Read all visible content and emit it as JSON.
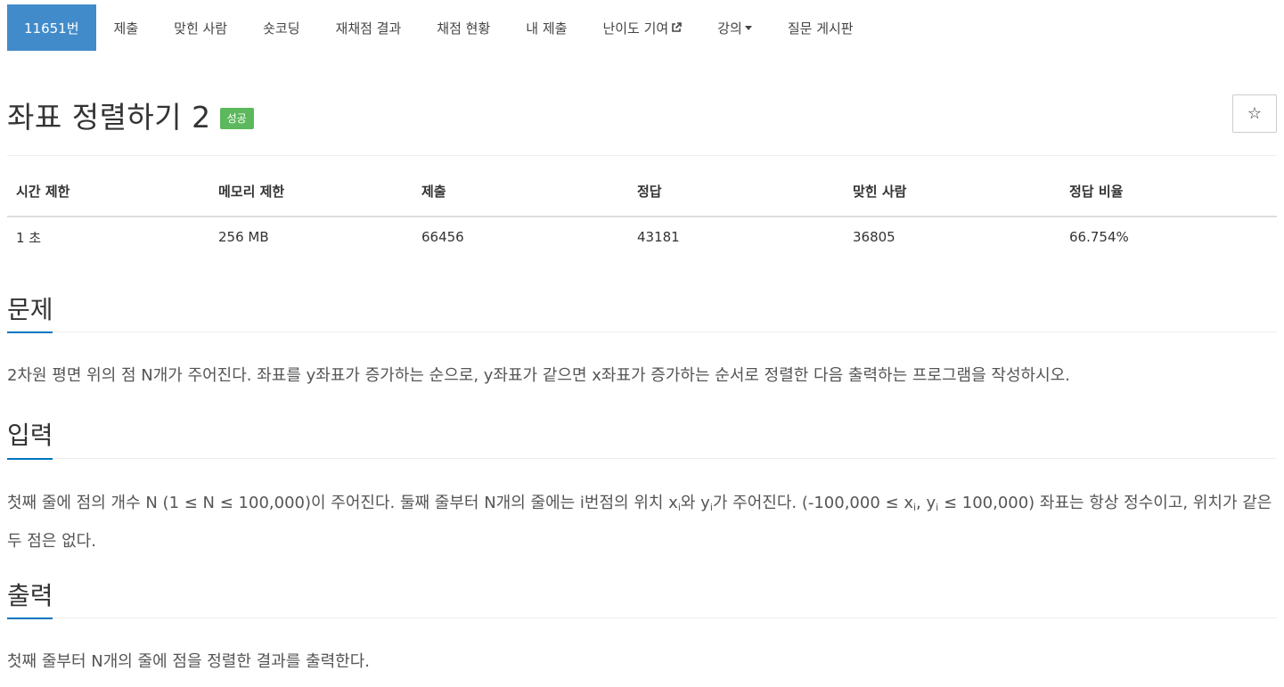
{
  "nav": {
    "problem_id": "11651번",
    "items": [
      "제출",
      "맞힌 사람",
      "숏코딩",
      "재채점 결과",
      "채점 현황",
      "내 제출",
      "난이도 기여",
      "강의",
      "질문 게시판"
    ]
  },
  "title": "좌표 정렬하기 2",
  "badge": "성공",
  "star": "☆",
  "stats": {
    "headers": [
      "시간 제한",
      "메모리 제한",
      "제출",
      "정답",
      "맞힌 사람",
      "정답 비율"
    ],
    "values": [
      "1 초",
      "256 MB",
      "66456",
      "43181",
      "36805",
      "66.754%"
    ]
  },
  "sections": {
    "problem": {
      "heading": "문제",
      "text": "2차원 평면 위의 점 N개가 주어진다. 좌표를 y좌표가 증가하는 순으로, y좌표가 같으면 x좌표가 증가하는 순서로 정렬한 다음 출력하는 프로그램을 작성하시오."
    },
    "input": {
      "heading": "입력",
      "t1": "첫째 줄에 점의 개수 N (1 ≤ N ≤ 100,000)이 주어진다. 둘째 줄부터 N개의 줄에는 i번점의 위치 x",
      "s1": "i",
      "t2": "와 y",
      "s2": "i",
      "t3": "가 주어진다. (-100,000 ≤ x",
      "s3": "i",
      "t4": ", y",
      "s4": "i",
      "t5": " ≤ 100,000) 좌표는 항상 정수이고, 위치가 같은 두 점은 없다."
    },
    "output": {
      "heading": "출력",
      "text": "첫째 줄부터 N개의 줄에 점을 정렬한 결과를 출력한다."
    }
  }
}
